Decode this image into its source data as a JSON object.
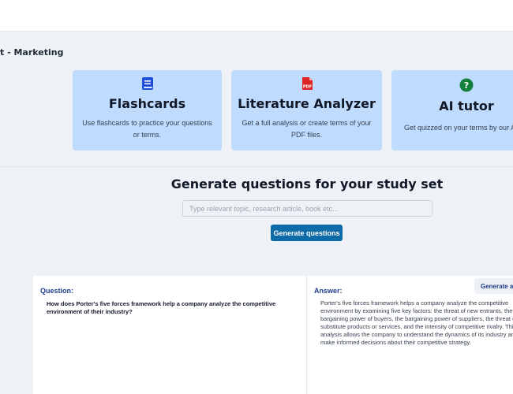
{
  "header": {
    "study_set_title": "t - Marketing"
  },
  "tools": [
    {
      "title": "Flashcards",
      "description": "Use flashcards to practice your questions or terms.",
      "icon": "book-icon",
      "color": "#1d4ed8"
    },
    {
      "title": "Literature Analyzer",
      "description": "Get a full analysis or create terms of your PDF files.",
      "icon": "pdf-file-icon",
      "icon_text": "PDF",
      "color": "#dc2626"
    },
    {
      "title": "AI tutor",
      "description": "Get quizzed on your terms by our AI",
      "icon": "question-circle-icon",
      "icon_text": "?",
      "color": "#15803d"
    }
  ],
  "generator": {
    "title": "Generate questions for your study set",
    "placeholder": "Type relevant topic, research article, book etc...",
    "input_value": "",
    "button_label": "Generate questions",
    "button_color": "#0f6aa8"
  },
  "qa": {
    "question_label": "Question:",
    "question_text": "How does Porter's five forces framework help a company analyze the competitive environment of their industry?",
    "answer_label": "Answer:",
    "answer_text": "Porter's five forces framework helps a company analyze the competitive environment by examining five key factors: the threat of new entrants, the bargaining power of buyers, the bargaining power of suppliers, the threat of substitute products or services, and the intensity of competitive rivalry. This analysis allows the company to understand the dynamics of its industry and make informed decisions about their competitive strategy.",
    "generate_answer_label": "Generate answer"
  }
}
